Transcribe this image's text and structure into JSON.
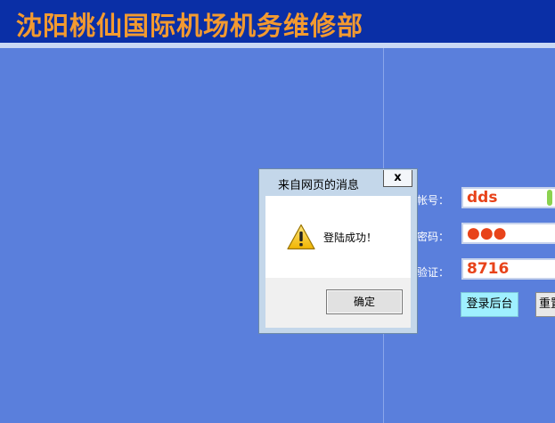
{
  "header": {
    "title": "沈阳桃仙国际机场机务维修部"
  },
  "login_form": {
    "account_label": "帐号：",
    "account_value": "dds",
    "password_label": "密码：",
    "password_masked": "●●●",
    "captcha_label": "验证：",
    "captcha_value": "8716",
    "login_button": "登录后台",
    "reset_button": "重置"
  },
  "dialog": {
    "title": "来自网页的消息",
    "close_label": "x",
    "message": "登陆成功！",
    "ok_button": "确定",
    "icon": "warning-icon"
  },
  "colors": {
    "background": "#5a7fdc",
    "header": "#0a2fa6",
    "title_text": "#f39a30",
    "input_text": "#e8431a",
    "login_button": "#9ff0ff"
  }
}
